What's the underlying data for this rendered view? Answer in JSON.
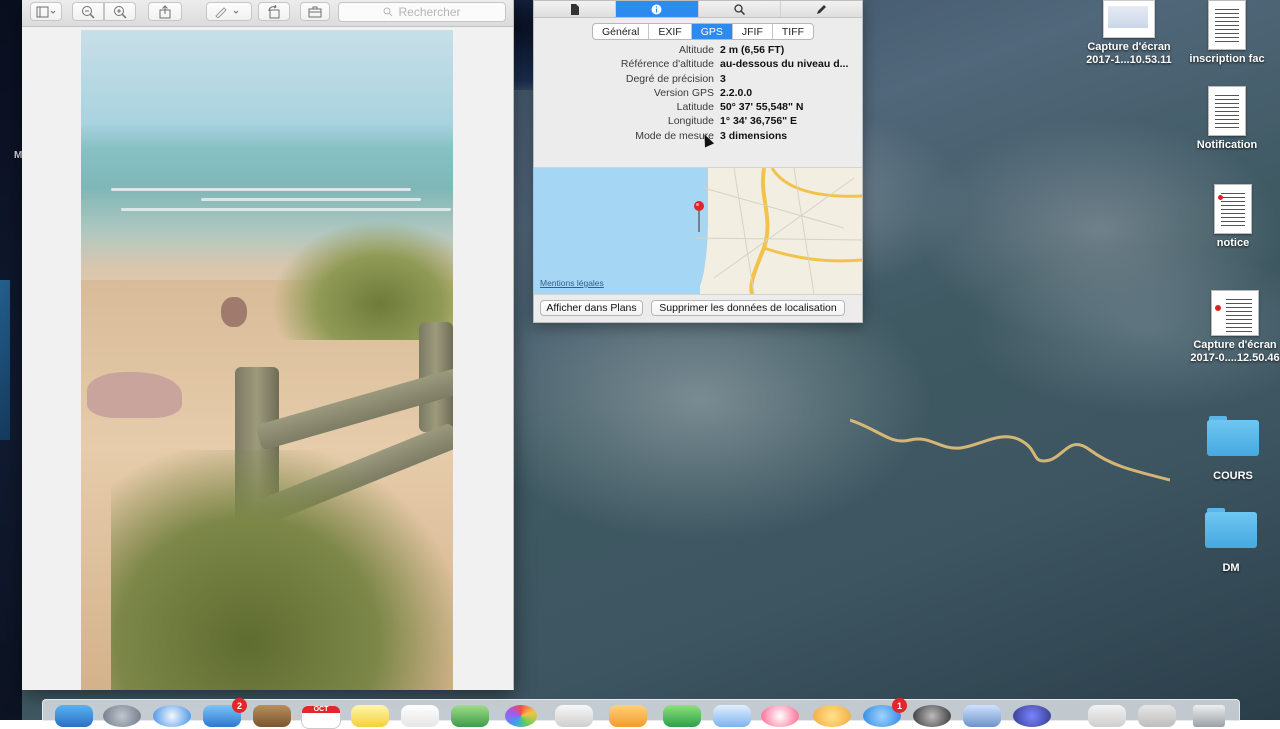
{
  "preview": {
    "search_placeholder": "Rechercher"
  },
  "inspector": {
    "tab_icons": [
      "document-icon",
      "info-icon",
      "search-icon",
      "edit-icon"
    ],
    "segments": [
      "Général",
      "EXIF",
      "GPS",
      "JFIF",
      "TIFF"
    ],
    "active_segment": "GPS",
    "gps_rows": [
      {
        "key": "Altitude",
        "value": "2 m (6,56 FT)"
      },
      {
        "key": "Référence d'altitude",
        "value": "au-dessous du niveau d..."
      },
      {
        "key": "Degré de précision",
        "value": "3"
      },
      {
        "key": "Version GPS",
        "value": "2.2.0.0"
      },
      {
        "key": "Latitude",
        "value": "50° 37' 55,548\" N"
      },
      {
        "key": "Longitude",
        "value": "1° 34' 36,756\" E"
      },
      {
        "key": "Mode de mesure",
        "value": "3 dimensions"
      }
    ],
    "map_legal": "Mentions légales",
    "show_in_maps": "Afficher dans Plans",
    "remove_location": "Supprimer les données de localisation"
  },
  "desktop_icons": [
    {
      "label": "Capture d'écran 2017-1...10.53.11"
    },
    {
      "label": "inscription fac"
    },
    {
      "label": "Notification"
    },
    {
      "label": "notice"
    },
    {
      "label": "Capture d'écran 2017-0....12.50.46"
    },
    {
      "label": "COURS"
    },
    {
      "label": "DM"
    }
  ],
  "left_stub_text": "M",
  "dock": {
    "mail_badge": "2",
    "calendar_month": "OCT",
    "appstore_badge": "1"
  },
  "colors": {
    "selection_blue": "#2d8bf0",
    "folder_blue": "#46a9e0"
  }
}
